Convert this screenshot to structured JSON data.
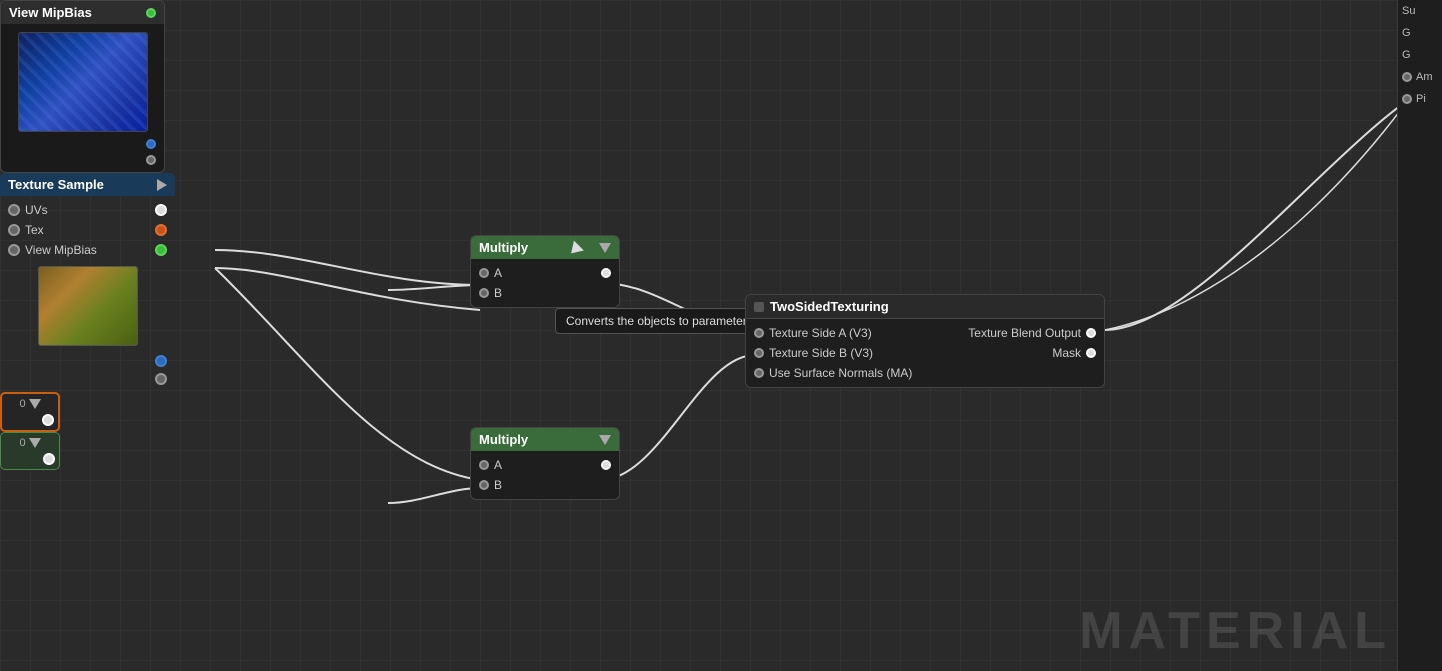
{
  "canvas": {
    "background": "#2a2a2a"
  },
  "nodes": {
    "textureSample": {
      "title": "Texture Sample",
      "pins": [
        {
          "label": "UVs",
          "pinColor": "gray"
        },
        {
          "label": "Tex",
          "pinColor": "orange"
        },
        {
          "label": "View MipBias",
          "pinColor": "green"
        }
      ],
      "outputPins": [
        {
          "label": "",
          "pinColor": "blue"
        },
        {
          "label": "",
          "pinColor": "gray"
        }
      ]
    },
    "topPreview": {
      "title": "View MipBias",
      "outputPins": [
        {
          "label": "",
          "pinColor": "green"
        },
        {
          "label": "",
          "pinColor": "blue"
        },
        {
          "label": "",
          "pinColor": "gray"
        }
      ]
    },
    "const1": {
      "label": "0",
      "borderColor": "orange"
    },
    "const2": {
      "label": "0",
      "borderColor": "green"
    },
    "multiply1": {
      "title": "Multiply",
      "inputPins": [
        {
          "label": "A"
        },
        {
          "label": "B"
        }
      ],
      "outputPin": {
        "label": ""
      }
    },
    "multiply2": {
      "title": "Multiply",
      "inputPins": [
        {
          "label": "A"
        },
        {
          "label": "B"
        }
      ],
      "outputPin": {
        "label": ""
      }
    },
    "twoSided": {
      "title": "TwoSidedTexturing",
      "inputPins": [
        {
          "label": "Texture Side A (V3)"
        },
        {
          "label": "Texture Side B (V3)"
        },
        {
          "label": "Use Surface Normals (MA)"
        }
      ],
      "outputPins": [
        {
          "label": "Texture Blend Output"
        },
        {
          "label": "Mask"
        }
      ]
    }
  },
  "tooltip": {
    "text": "Converts the objects to parameters"
  },
  "rightPanel": {
    "pins": [
      {
        "label": "Su"
      },
      {
        "label": "G"
      },
      {
        "label": "G"
      },
      {
        "label": "Am",
        "hasCircle": true
      },
      {
        "label": "Pi",
        "hasCircle": true
      }
    ]
  },
  "watermark": {
    "text": "MATERIAL"
  }
}
